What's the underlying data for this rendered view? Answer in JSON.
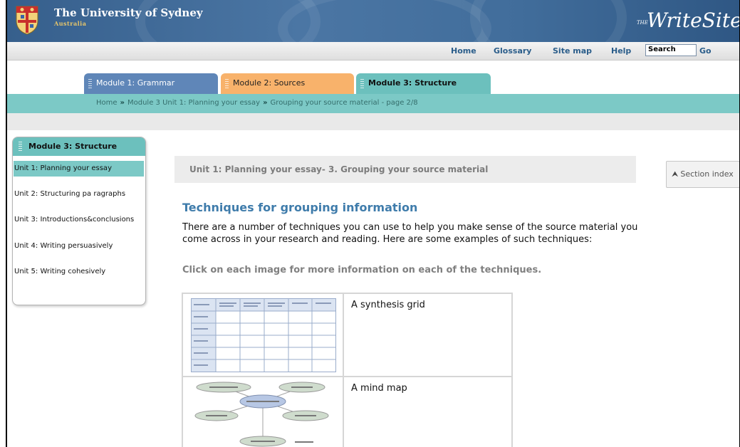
{
  "banner": {
    "university_name": "The University of Sydney",
    "university_sub": "Australia",
    "logo_prefix": "THE",
    "logo_text": "WriteSite"
  },
  "topnav": {
    "items": [
      "Home",
      "Glossary",
      "Site map",
      "Help"
    ],
    "search_value": "Search",
    "go_label": "Go"
  },
  "tabs": [
    {
      "label": "Module 1: Grammar"
    },
    {
      "label": "Module 2: Sources"
    },
    {
      "label": "Module 3: Structure"
    }
  ],
  "breadcrumb": {
    "items": [
      "Home",
      "Module 3 Unit 1: Planning your essay",
      "Grouping your source material - page 2/8"
    ],
    "separator": "»"
  },
  "sidebar": {
    "title": "Module 3: Structure",
    "items": [
      {
        "label": "Unit 1: Planning your essay",
        "active": true
      },
      {
        "label": "Unit 2: Structuring pa ragraphs",
        "active": false
      },
      {
        "label": "Unit 3: Introductions&conclusions",
        "active": false
      },
      {
        "label": "Unit 4: Writing persuasively",
        "active": false
      },
      {
        "label": "Unit 5: Writing cohesively",
        "active": false
      }
    ]
  },
  "main": {
    "unit_title": "Unit 1: Planning your essay- 3. Grouping your source material",
    "section_index_label": "Section index",
    "heading": "Techniques for grouping information",
    "intro": "There are a number of techniques you can use to help you make sense of the source material you come across in your research and reading. Here are some examples of such techniques:",
    "instruction": "Click on each image for more information on each of the techniques.",
    "techniques": [
      {
        "label": "A synthesis grid",
        "icon": "synthesis-grid-thumbnail"
      },
      {
        "label": "A mind map",
        "icon": "mind-map-thumbnail"
      }
    ]
  },
  "colors": {
    "banner": "#416d9b",
    "tab_grammar": "#5f86b8",
    "tab_sources": "#f8b26b",
    "tab_structure": "#6cc0bd",
    "crumb_bar": "#7cc9c6",
    "link": "#2a5d8a",
    "heading": "#3f7cab"
  }
}
